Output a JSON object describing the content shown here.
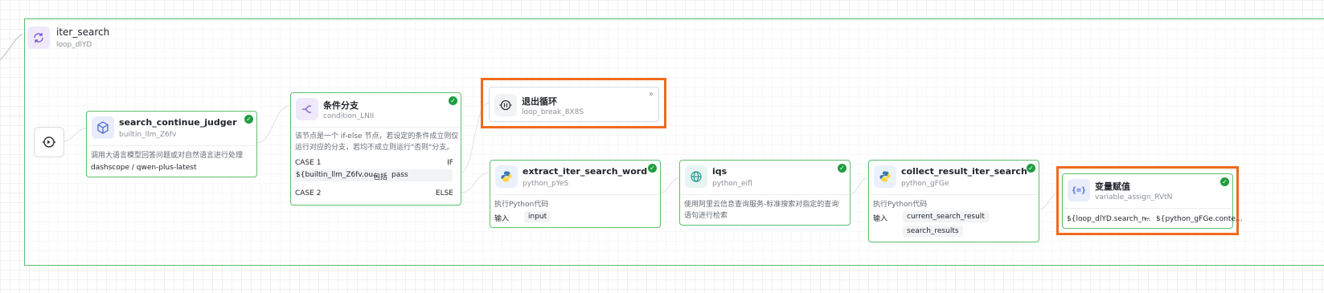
{
  "loop": {
    "title": "iter_search",
    "id": "loop_dlYD"
  },
  "nodes": {
    "judger": {
      "title": "search_continue_judger",
      "id": "builtin_llm_Z6fv",
      "desc": "调用大语言模型回答问题或对自然语言进行处理",
      "model": "dashscope / qwen-plus-latest"
    },
    "condition": {
      "title": "条件分支",
      "id": "condition_LNII",
      "desc_line1": "该节点是一个 if-else 节点，若设定的条件成立则仅",
      "desc_line2": "运行对应的分支，若均不成立则运行\"否则\"分支。",
      "case1": "CASE 1",
      "if_label": "IF",
      "cond_var": "${builtin_llm_Z6fv.ou...",
      "cond_op": "包括",
      "cond_val": "pass",
      "case2": "CASE 2",
      "else_label": "ELSE"
    },
    "break": {
      "title": "退出循环",
      "id": "loop_break_8X8S"
    },
    "extract": {
      "title": "extract_iter_search_word",
      "id": "python_pYeS",
      "desc": "执行Python代码",
      "input_label": "输入",
      "input_chip": "input"
    },
    "iqs": {
      "title": "iqs",
      "id": "python_eifl",
      "desc_line1": "使用阿里云信息查询服务-标准搜索对指定的查询",
      "desc_line2": "语句进行检索"
    },
    "collect": {
      "title": "collect_result_iter_search",
      "id": "python_gFGe",
      "desc": "执行Python代码",
      "input_label": "输入",
      "chip1": "current_search_result",
      "chip2": "search_results"
    },
    "assign": {
      "title": "变量赋值",
      "id": "variable_assign_RVtN",
      "left": "${loop_dlYD.search_r...",
      "arrow": "←",
      "right": "${python_gFGe.conte..."
    }
  },
  "colors": {
    "success_border": "#5cc06e",
    "highlight": "#f06a1d",
    "check": "#1f9d3f",
    "python_blue": "#3776ab",
    "python_yellow": "#ffd43b"
  }
}
